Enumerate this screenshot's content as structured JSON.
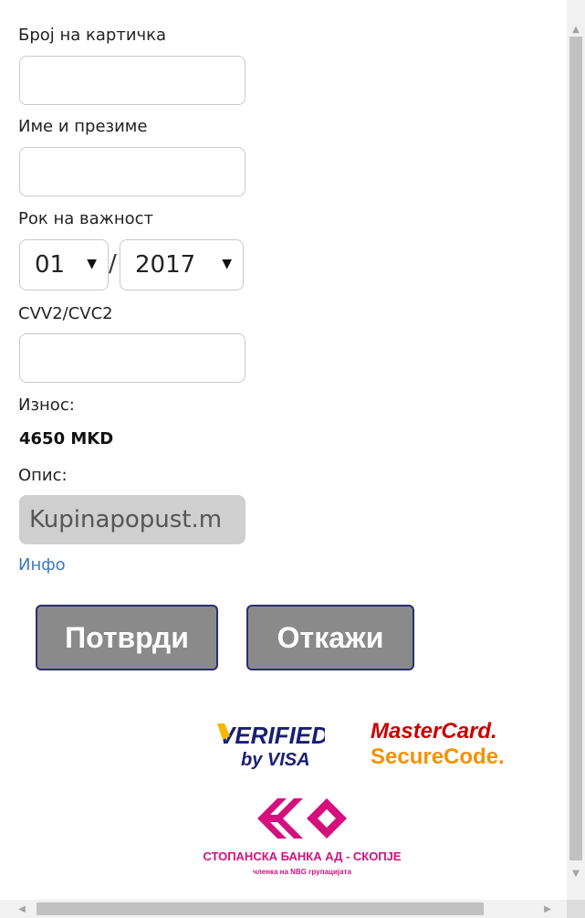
{
  "form": {
    "card_number_label": "Број на картичка",
    "card_number_value": "",
    "name_label": "Име и презиме",
    "name_value": "",
    "expiry_label": "Рок на важност",
    "expiry_month": "01",
    "expiry_separator": "/",
    "expiry_year": "2017",
    "cvv_label": "CVV2/CVC2",
    "cvv_value": "",
    "amount_label": "Износ:",
    "amount_value": "4650 MKD",
    "description_label": "Опис:",
    "description_value": "Kupinapopust.m",
    "info_link": "Инфо"
  },
  "actions": {
    "confirm_label": "Потврди",
    "cancel_label": "Откажи"
  },
  "logos": {
    "verified_line1": "VERIFIED",
    "verified_line2": "by VISA",
    "mastercard_line1": "MasterCard.",
    "mastercard_line2": "SecureCode.",
    "bank_name": "СТОПАНСКА БАНКА АД - СКОПЈЕ",
    "bank_sub": "членка на NBG групацијата"
  },
  "icons": {
    "dropdown": "caret-down-icon",
    "scroll_up": "arrow-up-icon",
    "scroll_down": "arrow-down-icon",
    "scroll_left": "arrow-left-icon",
    "scroll_right": "arrow-right-icon"
  },
  "colors": {
    "button_bg": "#8a8a8a",
    "button_border": "#2b2f6e",
    "link": "#3b78c8",
    "bank_magenta": "#d4107d",
    "mastercard_red": "#cc0000",
    "mastercard_orange": "#f39200",
    "visa_blue": "#1a1f71"
  }
}
